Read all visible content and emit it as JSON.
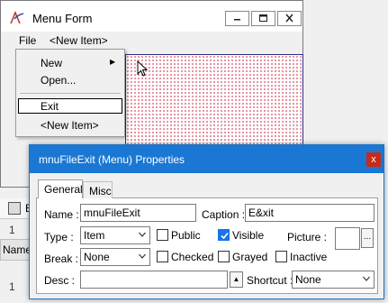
{
  "menu_form": {
    "title": "Menu Form",
    "menubar": {
      "file": "File",
      "new_item": "<New Item>"
    },
    "dropdown": {
      "items": [
        {
          "label": "New",
          "submenu": true
        },
        {
          "label": "Open..."
        },
        {
          "label": "Exit",
          "selected": true
        },
        {
          "label": "<New Item>"
        }
      ]
    }
  },
  "background": {
    "toolbar_text": "E",
    "row_number_top": "1",
    "name_header": "Name",
    "row_number_bottom": "1"
  },
  "properties_dialog": {
    "title": "mnuFileExit (Menu) Properties",
    "close_label": "x",
    "tabs": [
      {
        "label": "General",
        "active": true
      },
      {
        "label": "Misc",
        "active": false
      }
    ],
    "general": {
      "name_label": "Name :",
      "name_value": "mnuFileExit",
      "caption_label": "Caption :",
      "caption_value": "E&xit",
      "type_label": "Type :",
      "type_value": "Item",
      "break_label": "Break :",
      "break_value": "None",
      "desc_label": "Desc :",
      "desc_value": "",
      "public_label": "Public",
      "public_checked": false,
      "visible_label": "Visible",
      "visible_checked": true,
      "checked_label": "Checked",
      "checked_checked": false,
      "grayed_label": "Grayed",
      "grayed_checked": false,
      "inactive_label": "Inactive",
      "inactive_checked": false,
      "picture_label": "Picture :",
      "picture_button": "...",
      "shortcut_label": "Shortcut :",
      "shortcut_value": "None"
    }
  },
  "colors": {
    "dialog_titlebar": "#1a78d4",
    "close_button": "#c42b1c",
    "checkbox_checked": "#1a73e8",
    "grid_dots": "#e0788a"
  }
}
